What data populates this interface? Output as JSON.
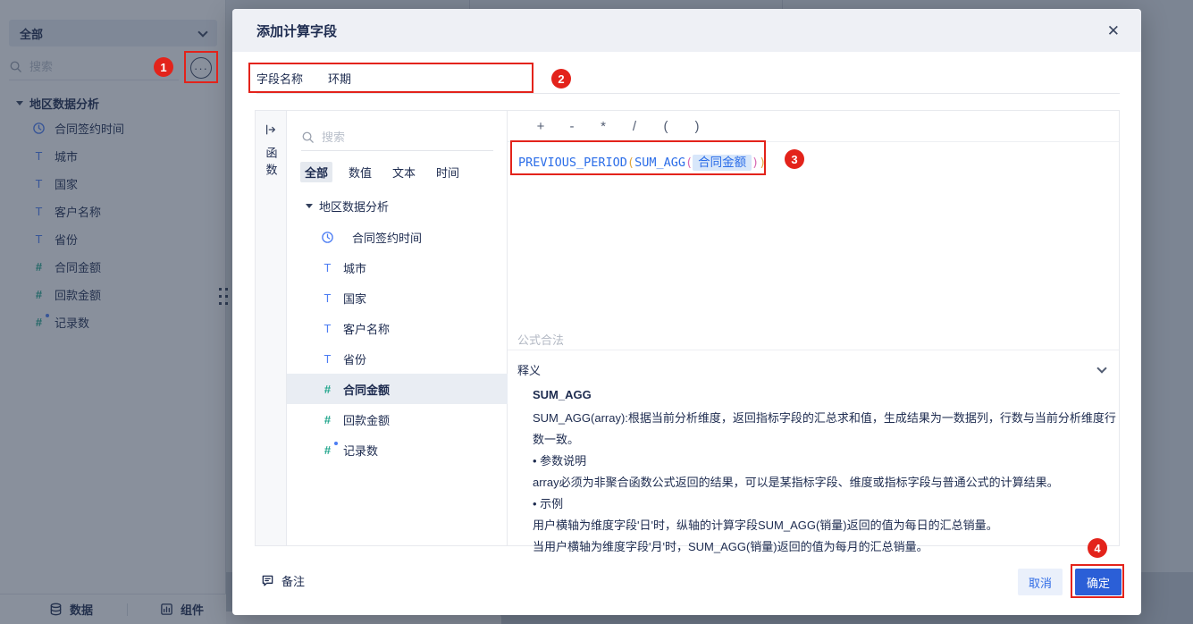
{
  "icons": {
    "close_glyph": "✕",
    "more_glyph": "···"
  },
  "colors": {
    "annotation_red": "#e3231b",
    "accent_blue": "#2b5fd7",
    "formula_function_blue": "#2b6de8",
    "paren_level1_gold": "#e0a63e",
    "paren_level2_pink": "#d86ab4",
    "field_chip_bg": "#d8e7fa",
    "icon_blue": "#4b7cf3",
    "icon_teal": "#21a68c"
  },
  "annotations": {
    "badge1": "1",
    "badge2": "2",
    "badge3": "3",
    "badge4": "4"
  },
  "sidebar": {
    "dataset_selector": "全部",
    "search_placeholder": "搜索",
    "tree_title": "地区数据分析",
    "fields": [
      {
        "name": "合同签约时间",
        "type": "date"
      },
      {
        "name": "城市",
        "type": "text"
      },
      {
        "name": "国家",
        "type": "text"
      },
      {
        "name": "客户名称",
        "type": "text"
      },
      {
        "name": "省份",
        "type": "text"
      },
      {
        "name": "合同金额",
        "type": "number"
      },
      {
        "name": "回款金额",
        "type": "number"
      },
      {
        "name": "记录数",
        "type": "record"
      }
    ],
    "type_icon_glyphs": {
      "text": "T",
      "number": "#"
    },
    "bottom_tabs": [
      {
        "label": "数据"
      },
      {
        "label": "组件"
      }
    ]
  },
  "dialog": {
    "title": "添加计算字段",
    "field_name_label": "字段名称",
    "field_name_value": "环期",
    "function_panel_label": "函数",
    "search_placeholder": "搜索",
    "type_tabs": [
      "全部",
      "数值",
      "文本",
      "时间"
    ],
    "tree_title": "地区数据分析",
    "selected_field": "合同金额",
    "operators": [
      "+",
      "-",
      "*",
      "/",
      "(",
      ")"
    ],
    "formula_tokens": [
      {
        "text": "PREVIOUS_PERIOD",
        "role": "function"
      },
      {
        "text": "(",
        "role": "paren-level1"
      },
      {
        "text": "SUM_AGG",
        "role": "function"
      },
      {
        "text": "(",
        "role": "paren-level2"
      },
      {
        "text": "合同金额",
        "role": "field-chip"
      },
      {
        "text": ")",
        "role": "paren-level2"
      },
      {
        "text": ")",
        "role": "paren-level1"
      }
    ],
    "status_text": "公式合法",
    "explain_header": "释义",
    "explain_function": "SUM_AGG",
    "explain_lines": [
      "SUM_AGG(array):根据当前分析维度，返回指标字段的汇总求和值，生成结果为一数据列，行数与当前分析维度行数一致。",
      "• 参数说明",
      "array必须为非聚合函数公式返回的结果，可以是某指标字段、维度或指标字段与普通公式的计算结果。",
      "• 示例",
      "用户横轴为维度字段'日'时，纵轴的计算字段SUM_AGG(销量)返回的值为每日的汇总销量。",
      "当用户横轴为维度字段'月'时，SUM_AGG(销量)返回的值为每月的汇总销量。"
    ],
    "note_label": "备注",
    "cancel_label": "取消",
    "ok_label": "确定"
  }
}
